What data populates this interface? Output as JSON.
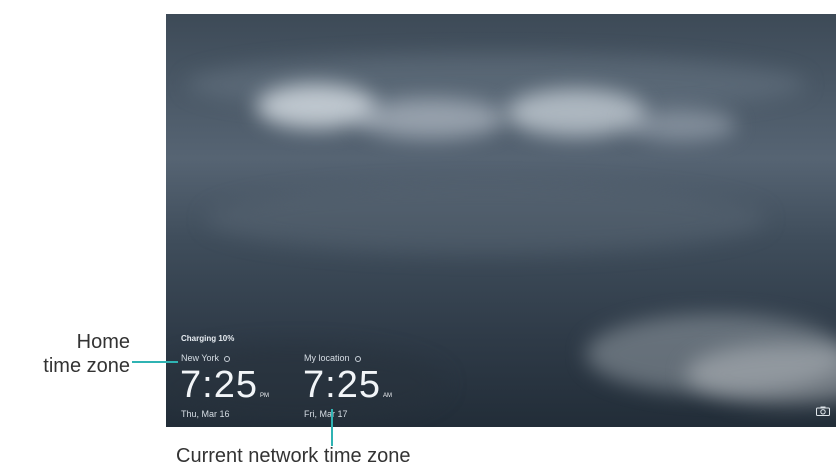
{
  "lockscreen": {
    "charging": "Charging 10%",
    "home": {
      "city": "New York",
      "time": "7:25",
      "ampm": "PM",
      "date": "Thu, Mar 16"
    },
    "network": {
      "city": "My location",
      "time": "7:25",
      "ampm": "AM",
      "date": "Fri, Mar 17"
    }
  },
  "callouts": {
    "home_label_line1": "Home",
    "home_label_line2": "time zone",
    "network_label": "Current network time zone"
  },
  "colors": {
    "callout_line": "#2fb3b3"
  },
  "icons": {
    "camera": "camera-icon",
    "home_clock_dot": "location-dot-icon"
  }
}
